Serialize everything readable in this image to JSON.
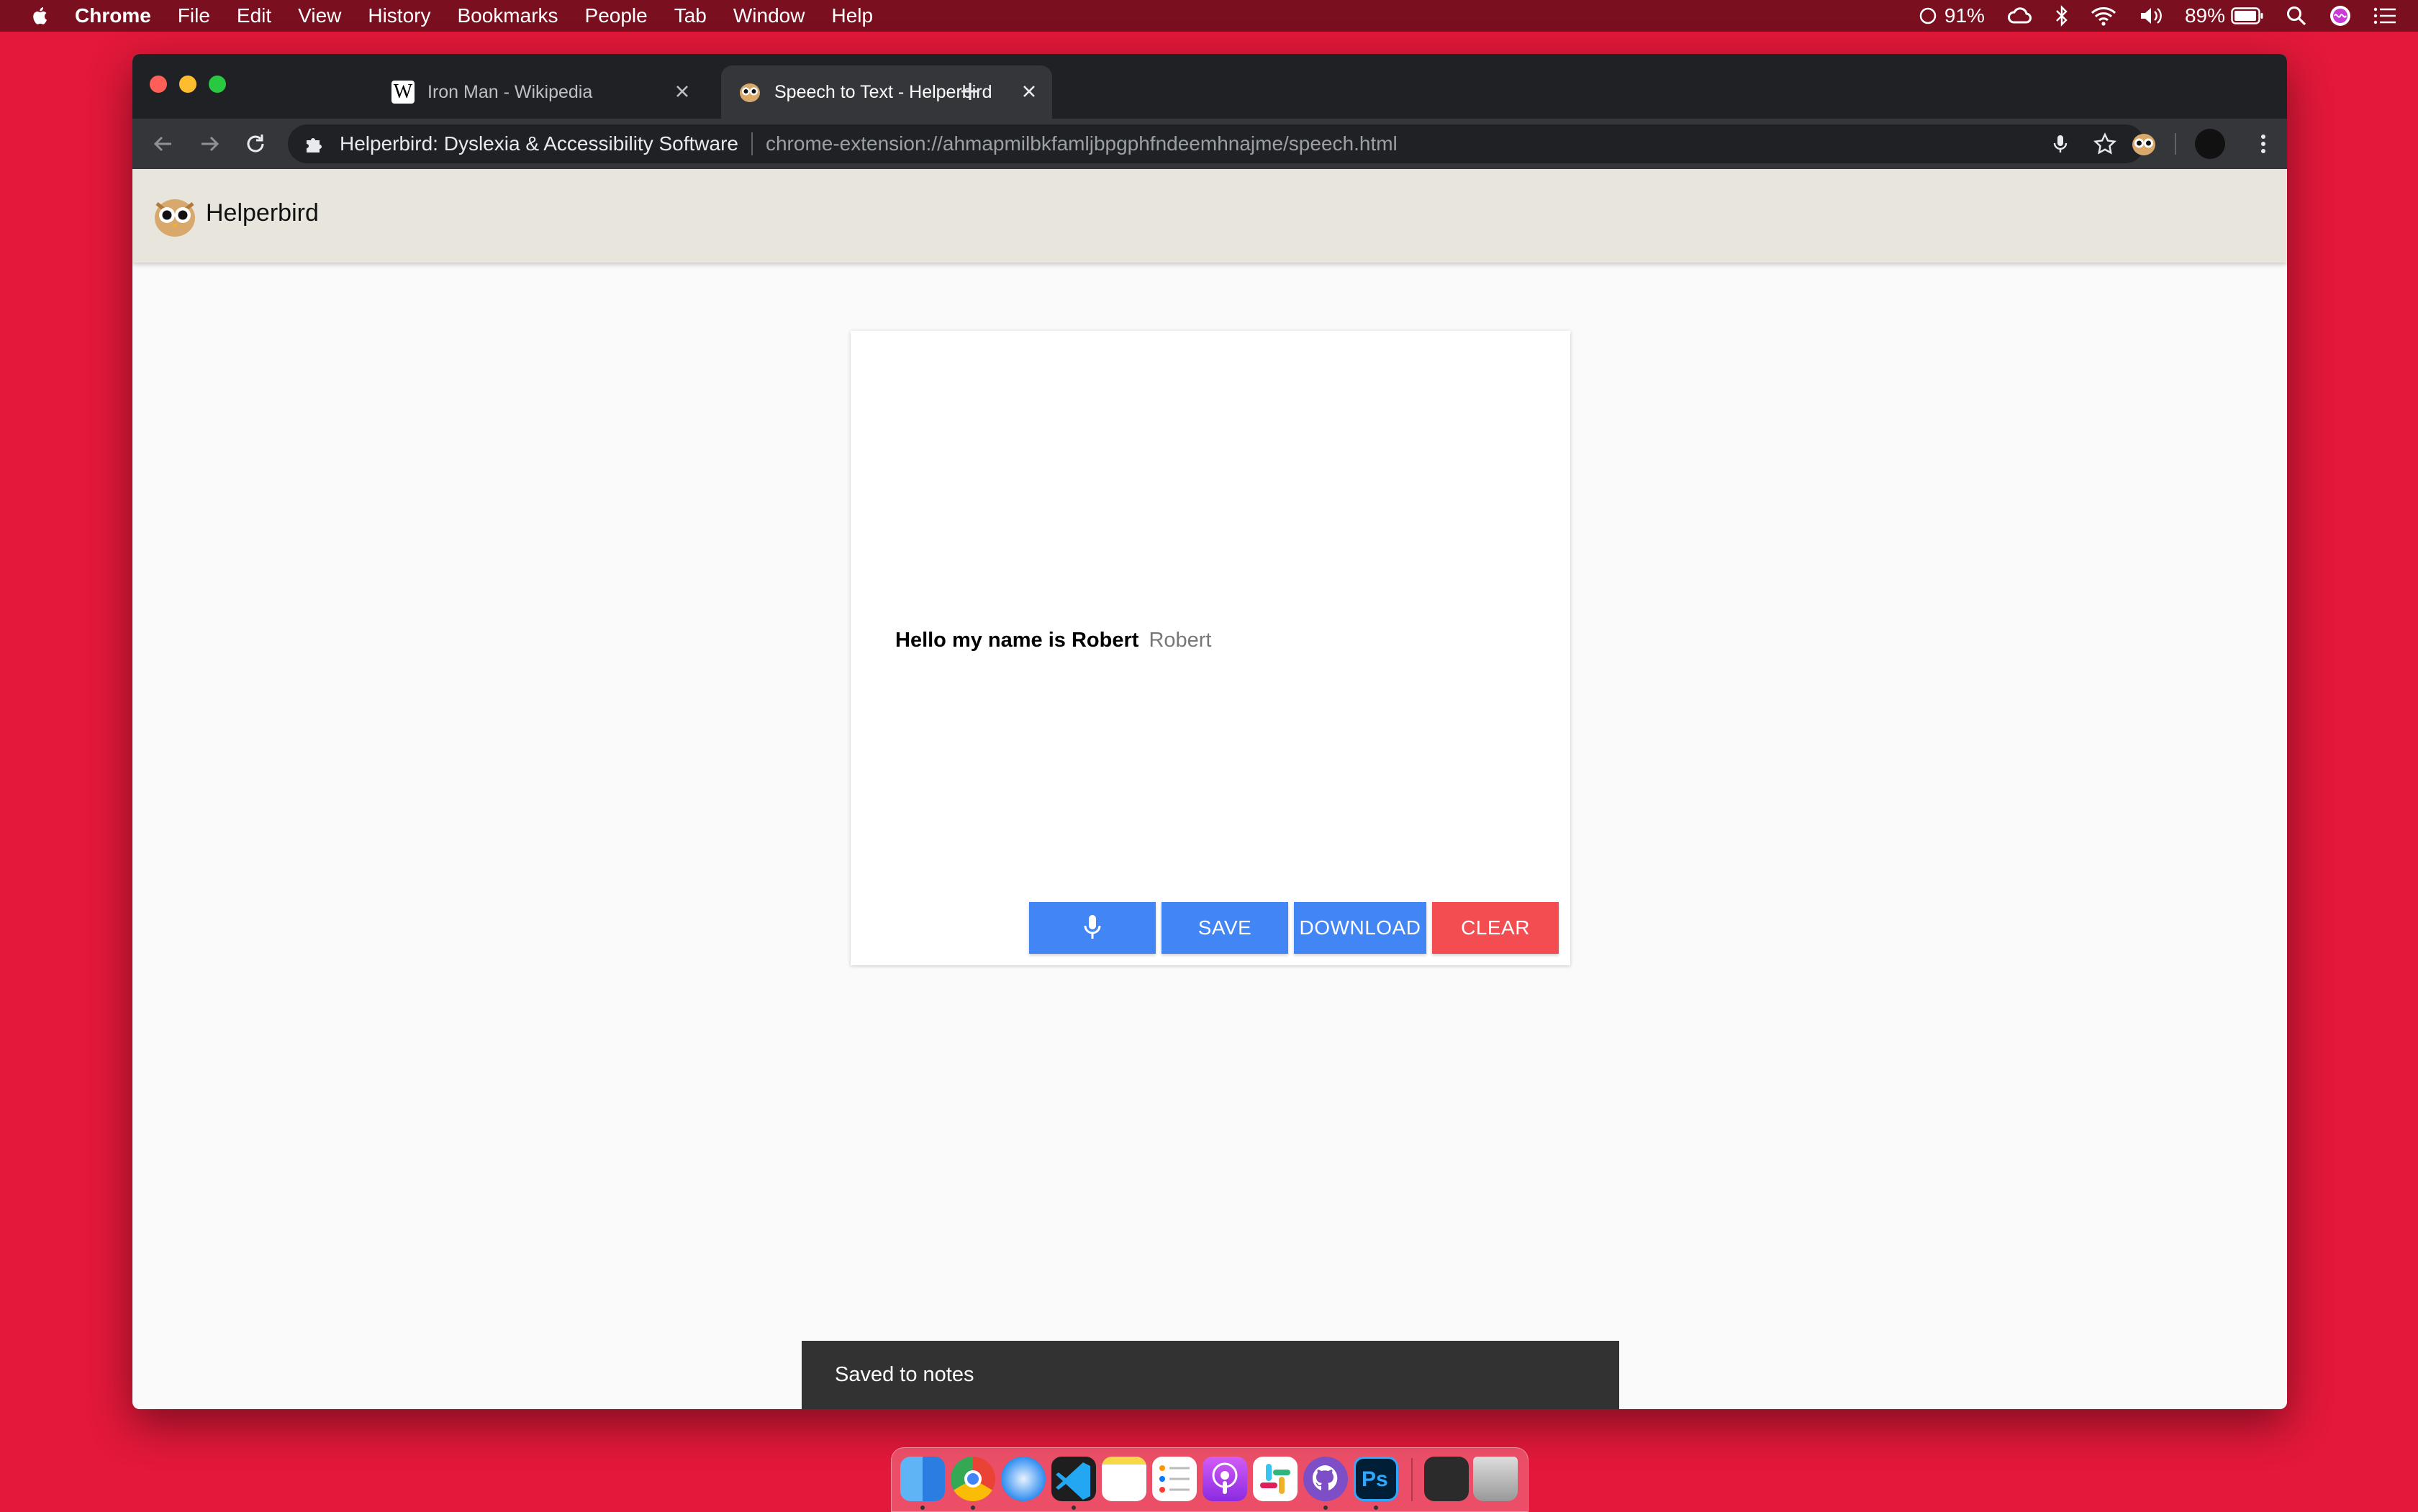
{
  "menubar": {
    "items": [
      "Chrome",
      "File",
      "Edit",
      "View",
      "History",
      "Bookmarks",
      "People",
      "Tab",
      "Window",
      "Help"
    ],
    "cpu_status": "91%",
    "battery": "89%"
  },
  "browser": {
    "tabs": [
      {
        "title": "Iron Man - Wikipedia",
        "active": false
      },
      {
        "title": "Speech to Text - Helperbird",
        "active": true
      }
    ],
    "omnibox": {
      "site_name": "Helperbird: Dyslexia & Accessibility Software",
      "url": "chrome-extension://ahmapmilbkfamljbpgphfndeemhnajme/speech.html"
    }
  },
  "page": {
    "brand": "Helperbird",
    "transcript_final": "Hello my name is Robert",
    "transcript_interim": "Robert",
    "buttons": {
      "save": "SAVE",
      "download": "DOWNLOAD",
      "clear": "CLEAR"
    },
    "snackbar": "Saved to notes"
  },
  "colors": {
    "desktop": "#e3183a",
    "primary_button": "#4285f4",
    "clear_button": "#f34d52",
    "header_bg": "#e8e6dc"
  },
  "icons": {
    "dock": [
      "finder-icon",
      "chrome-icon",
      "safari-icon",
      "vscode-icon",
      "notes-icon",
      "reminders-icon",
      "podcasts-icon",
      "slack-icon",
      "github-desktop-icon",
      "photoshop-icon",
      "terminal-icon",
      "trash-icon"
    ]
  }
}
